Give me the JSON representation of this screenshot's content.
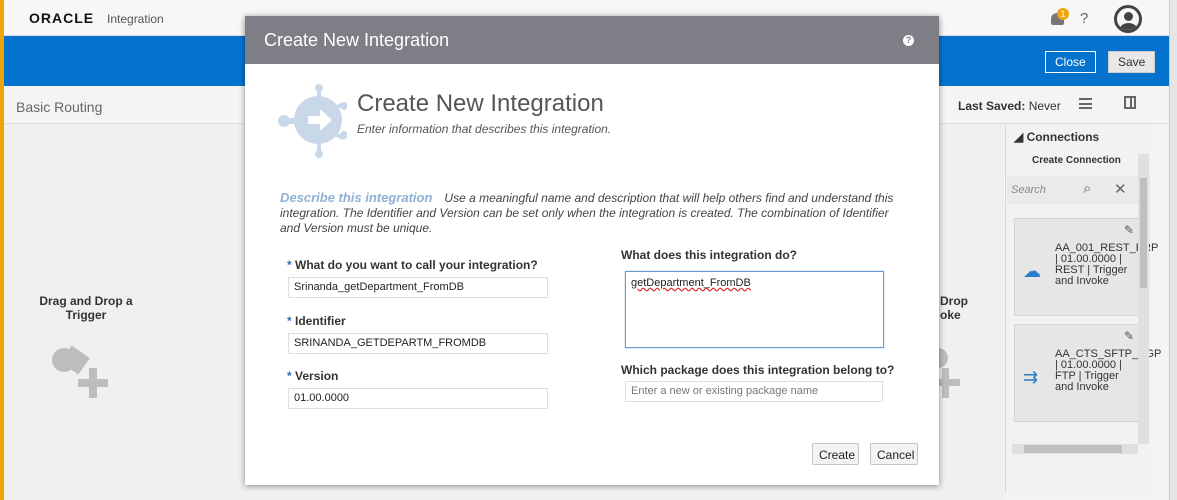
{
  "app": {
    "brand": "ORACLE",
    "product": "Integration",
    "notification_count": "1",
    "help_glyph": "?"
  },
  "toolbar": {
    "close_label": "Close",
    "save_label": "Save"
  },
  "integration": {
    "name": "Basic Routing",
    "last_saved_label": "Last Saved:",
    "last_saved_value": "Never"
  },
  "canvas": {
    "trigger_text": "Drag and Drop a Trigger",
    "invoke_text": "Drop\noke"
  },
  "connections": {
    "title": "Connections",
    "create_label": "Create Connection",
    "search_placeholder": "Search",
    "cards": [
      {
        "text": "AA_001_REST_ERP | 01.00.0000 | REST | Trigger and Invoke"
      },
      {
        "text": "AA_CTS_SFTP_PGP | 01.00.0000 | FTP | Trigger and Invoke"
      }
    ]
  },
  "modal": {
    "header_title": "Create New Integration",
    "hero_title": "Create New Integration",
    "hero_subtitle": "Enter information that describes this integration.",
    "description_heading": "Describe this integration",
    "description_text": "Use a meaningful name and description that will help others find and understand this integration. The Identifier and Version can be set only when the integration is created. The combination of Identifier and Version must be unique.",
    "fields": {
      "name_label": "What do you want to call your integration?",
      "name_value": "Srinanda_getDepartment_FromDB",
      "identifier_label": "Identifier",
      "identifier_value": "SRINANDA_GETDEPARTM_FROMDB",
      "version_label": "Version",
      "version_value": "01.00.0000",
      "what_label": "What does this integration do?",
      "what_value": "getDepartment_FromDB",
      "package_label": "Which package does this integration belong to?",
      "package_placeholder": "Enter a new or existing package name",
      "required_mark": "*"
    },
    "buttons": {
      "create": "Create",
      "cancel": "Cancel"
    }
  }
}
